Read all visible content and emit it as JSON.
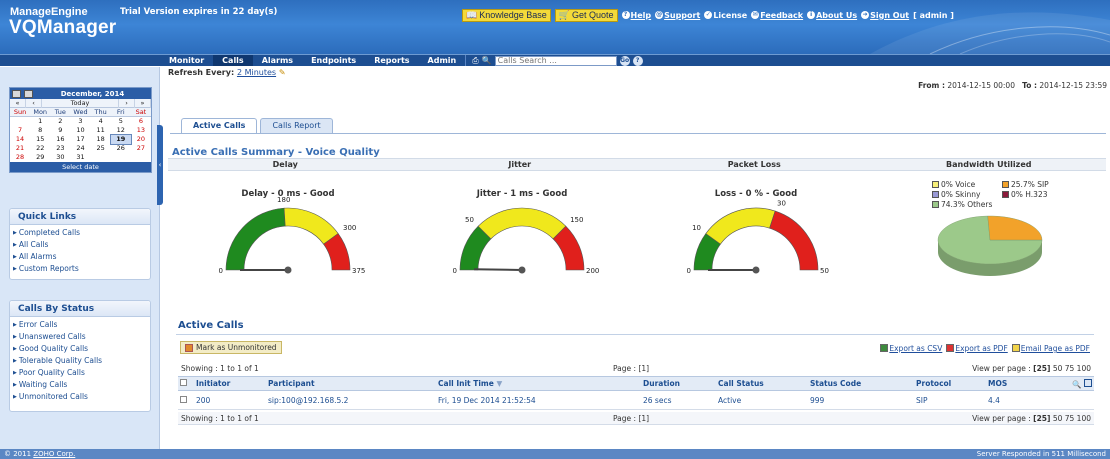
{
  "header": {
    "brand": "ManageEngine",
    "product": "VQManager",
    "trial_notice": "Trial Version expires in 22 day(s)",
    "knowledge_base": "Knowledge Base",
    "get_quote": "Get Quote",
    "help": "Help",
    "support": "Support",
    "license": "License",
    "feedback": "Feedback",
    "about": "About Us",
    "signout": "Sign Out",
    "user": "[ admin ]"
  },
  "nav": {
    "tabs": [
      "Monitor",
      "Calls",
      "Alarms",
      "Endpoints",
      "Reports",
      "Admin"
    ],
    "active_tab": "Calls",
    "search_placeholder": "Calls Search ..."
  },
  "calendar": {
    "title": "December, 2014",
    "prev_year": "«",
    "prev_month": "‹",
    "today": "Today",
    "next_month": "›",
    "next_year": "»",
    "day_headers": [
      "Sun",
      "Mon",
      "Tue",
      "Wed",
      "Thu",
      "Fri",
      "Sat"
    ],
    "days": [
      "",
      "1",
      "2",
      "3",
      "4",
      "5",
      "6",
      "7",
      "8",
      "9",
      "10",
      "11",
      "12",
      "13",
      "14",
      "15",
      "16",
      "17",
      "18",
      "19",
      "20",
      "21",
      "22",
      "23",
      "24",
      "25",
      "26",
      "27",
      "28",
      "29",
      "30",
      "31",
      "",
      "",
      ""
    ],
    "selected": "19",
    "footer": "Select date"
  },
  "quick_links": {
    "title": "Quick Links",
    "items": [
      "Completed Calls",
      "All Calls",
      "All Alarms",
      "Custom Reports"
    ]
  },
  "calls_by_status": {
    "title": "Calls By Status",
    "items": [
      "Error Calls",
      "Unanswered Calls",
      "Good Quality Calls",
      "Tolerable Quality Calls",
      "Poor Quality Calls",
      "Waiting Calls",
      "Unmonitored Calls"
    ]
  },
  "main": {
    "refresh_label": "Refresh Every:",
    "refresh_value": "2 Minutes",
    "from_label": "From :",
    "from_value": "2014-12-15 00:00",
    "to_label": "To :",
    "to_value": "2014-12-15 23:59",
    "subtabs": [
      "Active Calls",
      "Calls Report"
    ],
    "summary_title": "Active Calls Summary - Voice Quality",
    "summary_columns": [
      "Delay",
      "Jitter",
      "Packet Loss",
      "Bandwidth Utilized"
    ]
  },
  "gauges": [
    {
      "title": "Delay - 0 ms - Good",
      "value": 0,
      "max": 375,
      "t1": 180,
      "t2": 300,
      "labels": [
        "0",
        "180",
        "300",
        "375"
      ]
    },
    {
      "title": "Jitter - 1 ms - Good",
      "value": 1,
      "max": 200,
      "t1": 50,
      "t2": 150,
      "labels": [
        "0",
        "50",
        "150",
        "200"
      ]
    },
    {
      "title": "Loss - 0 % - Good",
      "value": 0,
      "max": 50,
      "t1": 10,
      "t2": 30,
      "labels": [
        "0",
        "10",
        "30",
        "50"
      ]
    }
  ],
  "gauge_colors": {
    "good": "#1f8a1f",
    "tolerable": "#f0e81c",
    "poor": "#e0201c"
  },
  "bandwidth": {
    "legend": [
      {
        "label": "0% Voice",
        "color": "#f7f07a"
      },
      {
        "label": "25.7% SIP",
        "color": "#f2a22a"
      },
      {
        "label": "0% Skinny",
        "color": "#9a9ad6"
      },
      {
        "label": "0% H.323",
        "color": "#8a1a3a"
      },
      {
        "label": "74.3% Others",
        "color": "#9cc98a"
      }
    ],
    "slices": [
      {
        "label": "Others",
        "value": 74.3,
        "color": "#9cc98a"
      },
      {
        "label": "SIP",
        "value": 25.7,
        "color": "#f2a22a"
      }
    ]
  },
  "active_calls": {
    "title": "Active Calls",
    "mark_button": "Mark as Unmonitored",
    "export_csv": "Export as CSV",
    "export_pdf": "Export as PDF",
    "email_pdf": "Email Page as PDF",
    "showing": "Showing : 1 to 1 of 1",
    "page": "Page : [1]",
    "view_per_page_label": "View per page :",
    "view_per_page_current": "[25]",
    "view_per_page_options": "50 75 100",
    "columns": [
      "Initiator",
      "Participant",
      "Call Init Time",
      "Duration",
      "Call Status",
      "Status Code",
      "Protocol",
      "MOS"
    ],
    "rows": [
      {
        "initiator": "200",
        "participant": "sip:100@192.168.5.2",
        "init_time": "Fri, 19 Dec 2014 21:52:54",
        "duration": "26 secs",
        "status": "Active",
        "code": "999",
        "protocol": "SIP",
        "mos": "4.4"
      }
    ]
  },
  "footer": {
    "copyright": "© 2011",
    "company": "ZOHO Corp.",
    "response": "Server Responded in 511 Millisecond"
  }
}
